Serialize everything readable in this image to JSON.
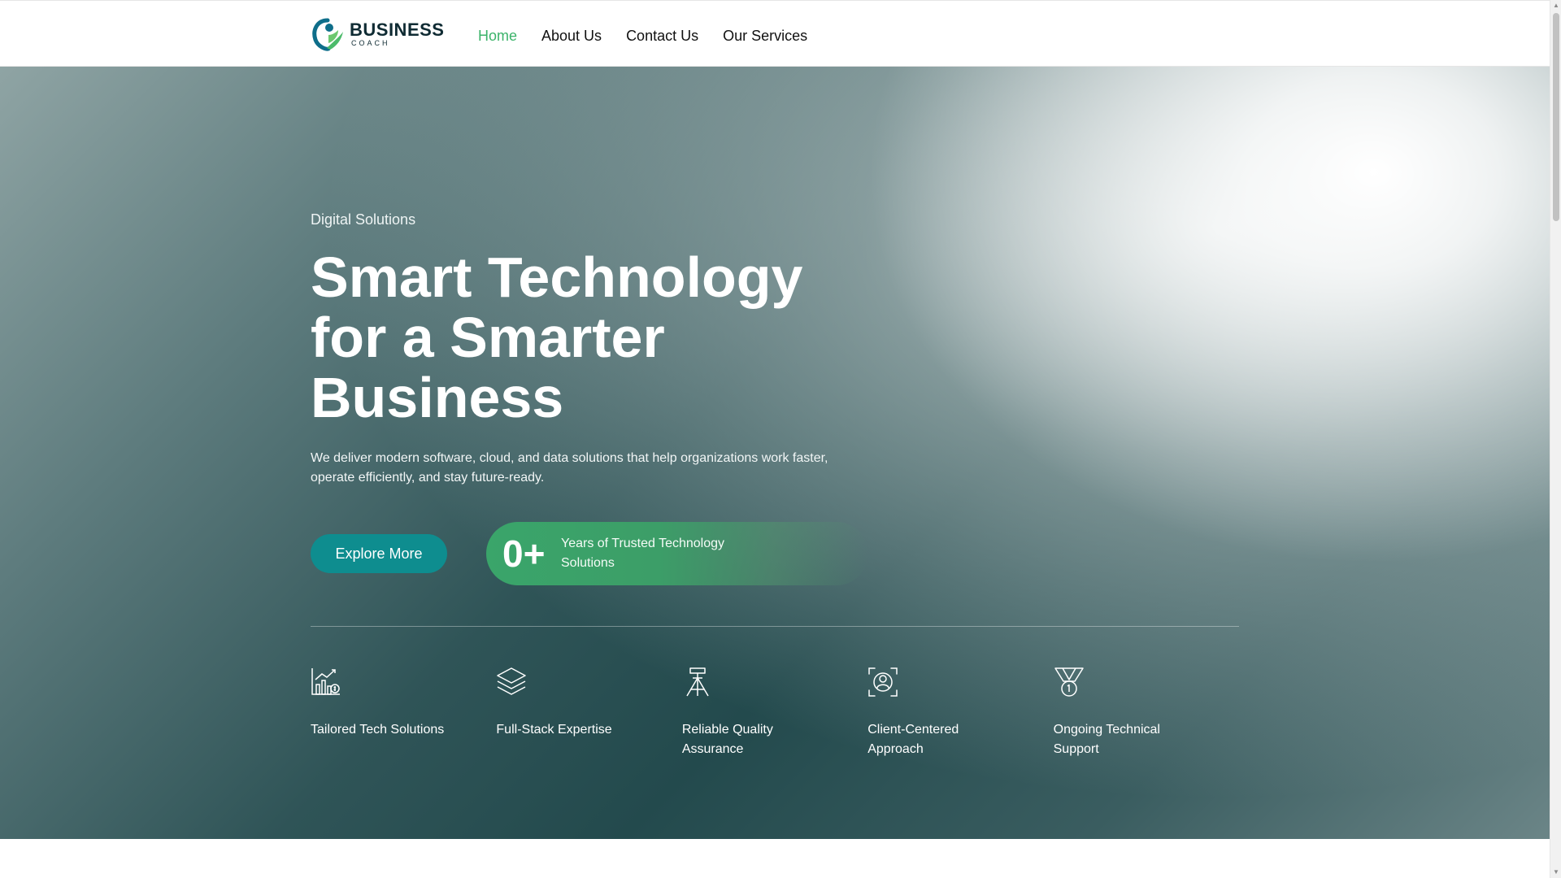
{
  "header": {
    "logo": {
      "main": "BUSINESS",
      "sub": "COACH"
    },
    "nav": [
      {
        "label": "Home",
        "active": true
      },
      {
        "label": "About Us",
        "active": false
      },
      {
        "label": "Contact Us",
        "active": false
      },
      {
        "label": "Our Services",
        "active": false
      }
    ]
  },
  "hero": {
    "eyebrow": "Digital Solutions",
    "title": "Smart Technology for a Smarter Business",
    "description": "We deliver modern software, cloud, and data solutions that help organizations work faster, operate efficiently, and stay future-ready.",
    "cta_label": "Explore More",
    "stat": {
      "number": "0+",
      "label": "Years of Trusted Technology Solutions"
    }
  },
  "features": [
    {
      "label": "Tailored Tech Solutions",
      "icon": "chart-growth-icon"
    },
    {
      "label": "Full-Stack Expertise",
      "icon": "layers-icon"
    },
    {
      "label": "Reliable Quality Assurance",
      "icon": "tripod-icon"
    },
    {
      "label": "Client-Centered Approach",
      "icon": "user-focus-icon"
    },
    {
      "label": "Ongoing Technical Support",
      "icon": "medal-icon"
    }
  ],
  "colors": {
    "accent_green": "#3bb36a",
    "button_teal": "#0e8d8f",
    "hero_dark": "#234a4d",
    "logo_dark": "#0f2b33"
  }
}
